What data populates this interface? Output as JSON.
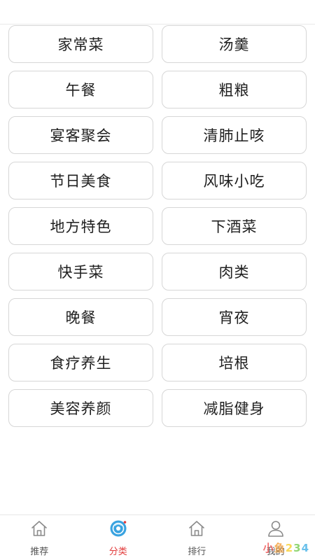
{
  "categories": [
    "家常菜",
    "汤羹",
    "午餐",
    "粗粮",
    "宴客聚会",
    "清肺止咳",
    "节日美食",
    "风味小吃",
    "地方特色",
    "下酒菜",
    "快手菜",
    "肉类",
    "晚餐",
    "宵夜",
    "食疗养生",
    "培根",
    "美容养颜",
    "减脂健身"
  ],
  "tabbar": {
    "tabs": [
      {
        "label": "推荐",
        "icon": "home-icon",
        "active": false
      },
      {
        "label": "分类",
        "icon": "category-icon",
        "active": true
      },
      {
        "label": "排行",
        "icon": "ranking-icon",
        "active": false
      },
      {
        "label": "我的",
        "icon": "profile-icon",
        "active": false
      }
    ]
  },
  "colors": {
    "accent": "#e23b3b",
    "active_icon": "#3aa3e0",
    "border": "#d6d6d6",
    "text": "#1f1f1f"
  },
  "watermark": {
    "chars": [
      "小",
      "鱼",
      "2",
      "3",
      "4"
    ]
  }
}
